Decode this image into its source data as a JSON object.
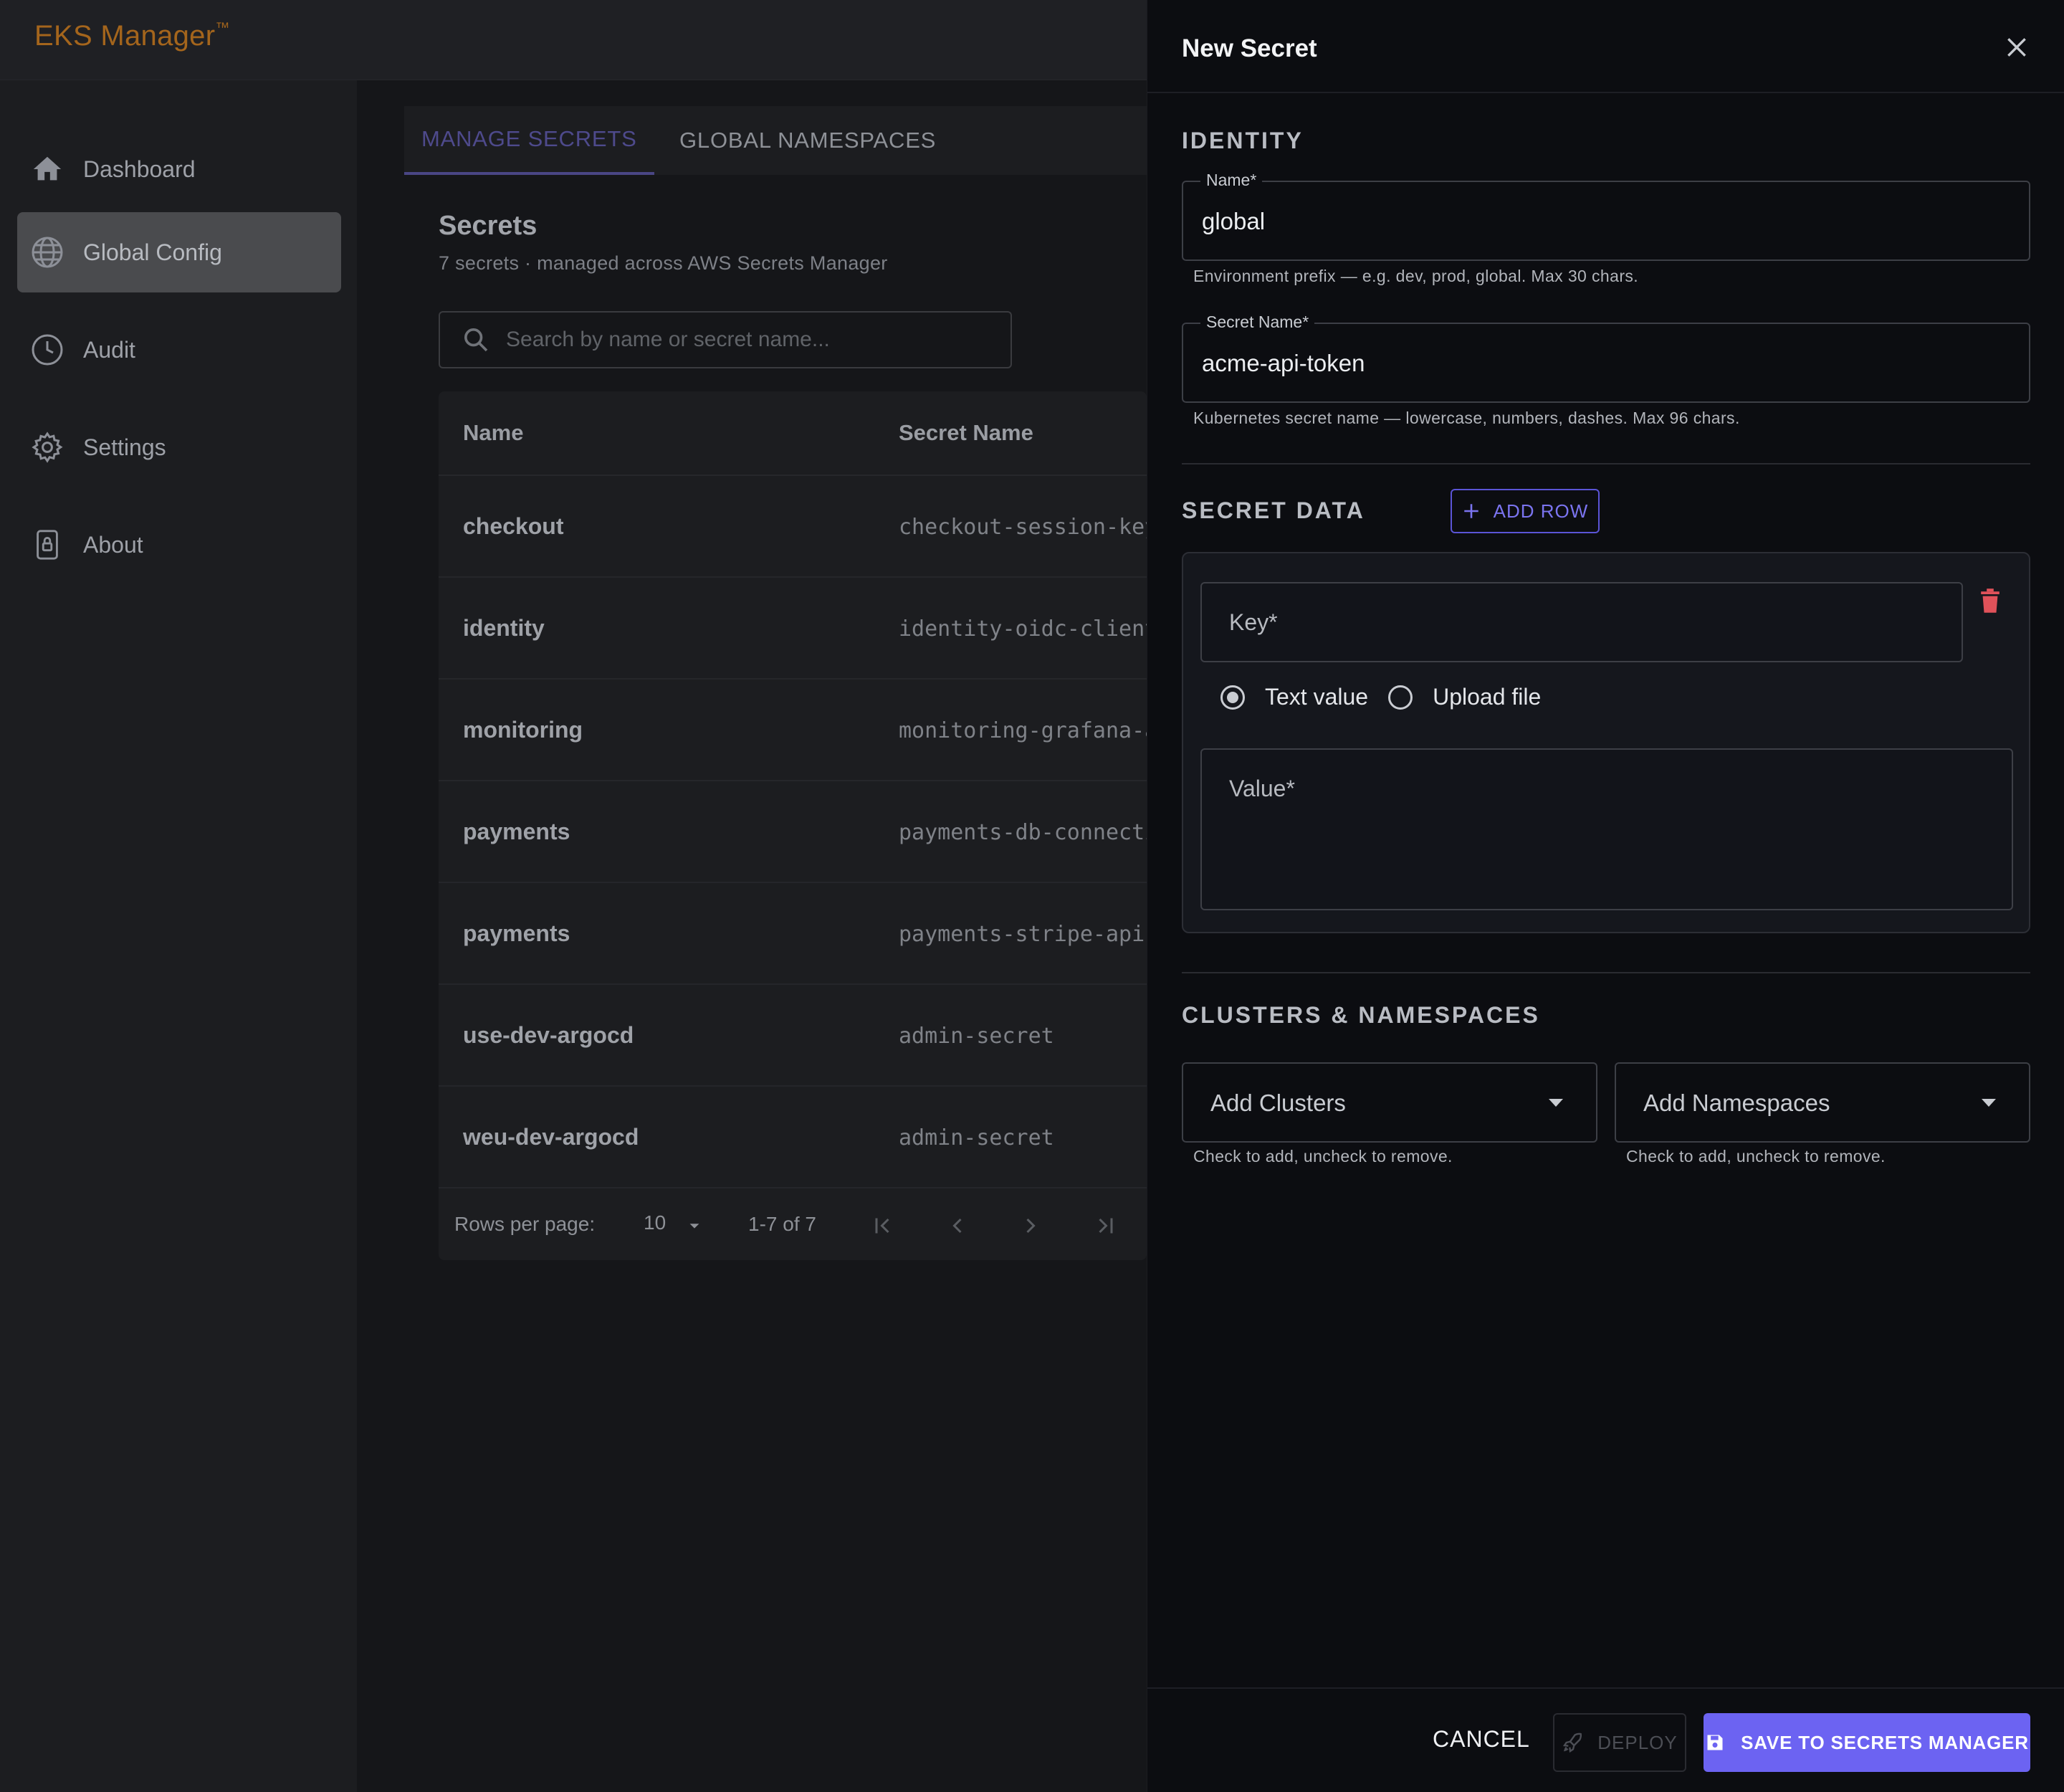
{
  "app": {
    "brand": "EKS Manager",
    "trademark": "™",
    "brand_color": "#a4651c"
  },
  "sidebar": {
    "items": [
      {
        "label": "Dashboard",
        "icon": "home-icon",
        "active": false
      },
      {
        "label": "Global Config",
        "icon": "globe-icon",
        "active": true
      },
      {
        "label": "Audit",
        "icon": "clock-icon",
        "active": false
      },
      {
        "label": "Settings",
        "icon": "gear-icon",
        "active": false
      },
      {
        "label": "About",
        "icon": "lock-icon",
        "active": false
      }
    ]
  },
  "tabs": [
    {
      "label": "MANAGE SECRETS",
      "active": true
    },
    {
      "label": "GLOBAL NAMESPACES",
      "active": false
    }
  ],
  "secrets": {
    "title": "Secrets",
    "subtitle": "7 secrets · managed across AWS Secrets Manager",
    "search_placeholder": "Search by name or secret name...",
    "columns": [
      "Name",
      "Secret Name"
    ],
    "rows": [
      {
        "name": "checkout",
        "secret_name": "checkout-session-key"
      },
      {
        "name": "identity",
        "secret_name": "identity-oidc-client"
      },
      {
        "name": "monitoring",
        "secret_name": "monitoring-grafana-a"
      },
      {
        "name": "payments",
        "secret_name": "payments-db-connecti"
      },
      {
        "name": "payments",
        "secret_name": "payments-stripe-api"
      },
      {
        "name": "use-dev-argocd",
        "secret_name": "admin-secret"
      },
      {
        "name": "weu-dev-argocd",
        "secret_name": "admin-secret"
      }
    ],
    "pagination": {
      "rows_per_page_label": "Rows per page:",
      "rows_per_page": "10",
      "range": "1-7 of 7"
    }
  },
  "drawer": {
    "title": "New Secret",
    "identity": {
      "heading": "IDENTITY",
      "name_label": "Name*",
      "name_value": "global",
      "name_helper": "Environment prefix — e.g. dev, prod, global. Max 30 chars.",
      "secret_name_label": "Secret Name*",
      "secret_name_value": "acme-api-token",
      "secret_name_helper": "Kubernetes secret name — lowercase, numbers, dashes. Max 96 chars."
    },
    "secret_data": {
      "heading": "SECRET DATA",
      "add_row_label": "ADD ROW",
      "key_placeholder": "Key*",
      "radio_text": "Text value",
      "radio_file": "Upload file",
      "selected_mode": "Text value",
      "value_placeholder": "Value*"
    },
    "clusters": {
      "heading": "CLUSTERS & NAMESPACES",
      "clusters_label": "Add Clusters",
      "namespaces_label": "Add Namespaces",
      "clusters_helper": "Check to add, uncheck to remove.",
      "namespaces_helper": "Check to add, uncheck to remove."
    },
    "footer": {
      "cancel": "CANCEL",
      "deploy": "DEPLOY",
      "save": "SAVE TO SECRETS MANAGER"
    },
    "accent_color": "#6c63f2",
    "danger_color": "#e0525a"
  }
}
